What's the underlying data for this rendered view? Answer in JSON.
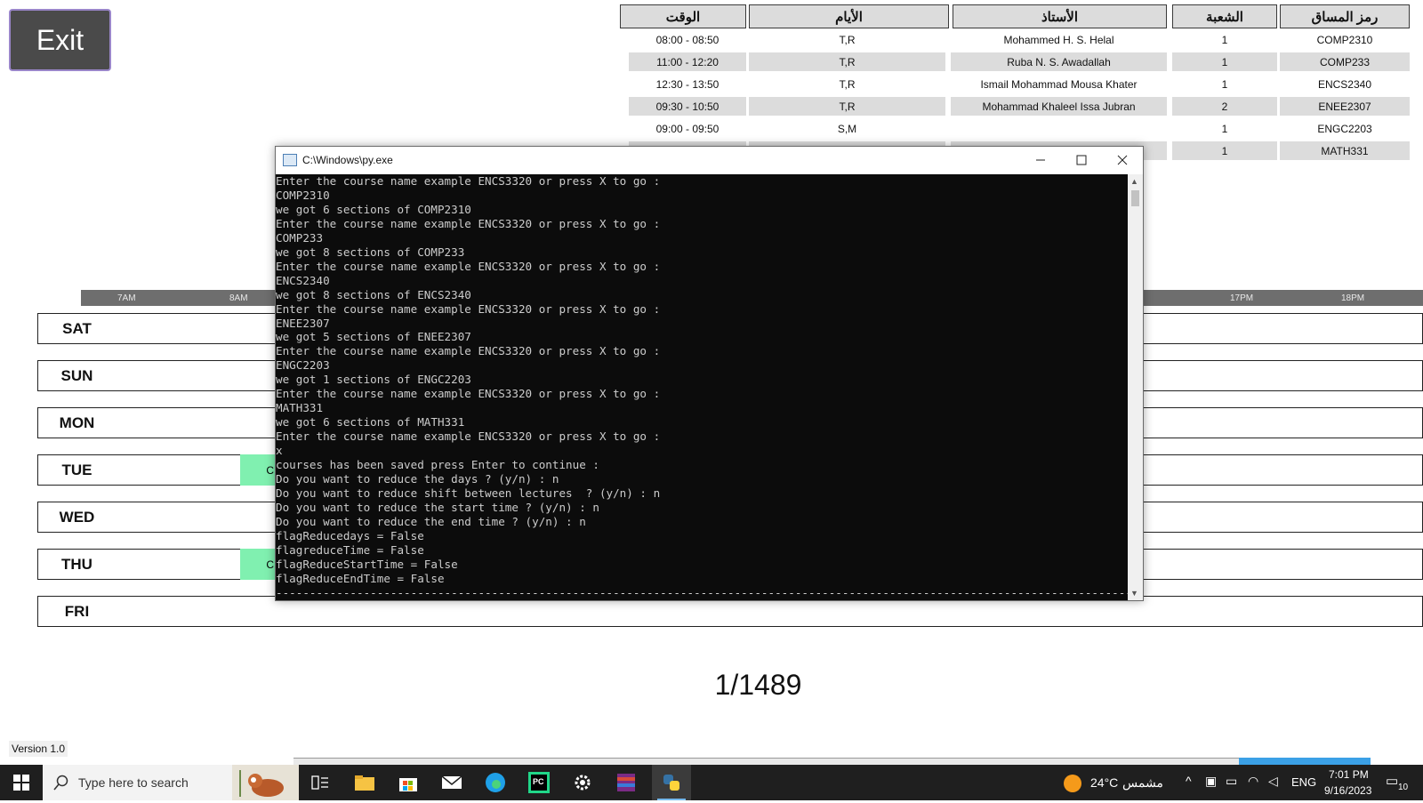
{
  "exit_button": {
    "label": "Exit"
  },
  "course_table": {
    "headers": [
      "الوقت",
      "الأيام",
      "الأستاذ",
      "الشعبة",
      "رمز المساق"
    ],
    "rows": [
      [
        "08:00 - 08:50",
        "T,R",
        "Mohammed H. S. Helal",
        "1",
        "COMP2310"
      ],
      [
        "11:00 - 12:20",
        "T,R",
        "Ruba N. S. Awadallah",
        "1",
        "COMP233"
      ],
      [
        "12:30 - 13:50",
        "T,R",
        "Ismail Mohammad Mousa Khater",
        "1",
        "ENCS2340"
      ],
      [
        "09:30 - 10:50",
        "T,R",
        "Mohammad Khaleel Issa Jubran",
        "2",
        "ENEE2307"
      ],
      [
        "09:00 - 09:50",
        "S,M",
        "",
        "1",
        "ENGC2203"
      ],
      [
        "",
        "",
        "",
        "1",
        "MATH331"
      ]
    ]
  },
  "schedule": {
    "hour_labels": [
      "7AM",
      "8AM",
      "17PM",
      "18PM"
    ],
    "days": [
      "SAT",
      "SUN",
      "MON",
      "TUE",
      "WED",
      "THU",
      "FRI"
    ],
    "block_label": "C"
  },
  "console": {
    "title": "C:\\Windows\\py.exe",
    "lines": [
      "Enter the course name example ENCS3320 or press X to go :",
      "COMP2310",
      "we got 6 sections of COMP2310",
      "Enter the course name example ENCS3320 or press X to go :",
      "COMP233",
      "we got 8 sections of COMP233",
      "Enter the course name example ENCS3320 or press X to go :",
      "ENCS2340",
      "we got 8 sections of ENCS2340",
      "Enter the course name example ENCS3320 or press X to go :",
      "ENEE2307",
      "we got 5 sections of ENEE2307",
      "Enter the course name example ENCS3320 or press X to go :",
      "ENGC2203",
      "we got 1 sections of ENGC2203",
      "Enter the course name example ENCS3320 or press X to go :",
      "MATH331",
      "we got 6 sections of MATH331",
      "Enter the course name example ENCS3320 or press X to go :",
      "x",
      "courses has been saved press Enter to continue :",
      "Do you want to reduce the days ? (y/n) : n",
      "Do you want to reduce shift between lectures  ? (y/n) : n",
      "Do you want to reduce the start time ? (y/n) : n",
      "Do you want to reduce the end time ? (y/n) : n",
      "flagReducedays = False",
      "flagreduceTime = False",
      "flagReduceStartTime = False",
      "flagReduceEndTime = False",
      "------------------------------------------------------------------------------------------------------------------------------------------"
    ]
  },
  "page_counter": "1/1489",
  "version": "Version 1.0",
  "taskbar": {
    "search_placeholder": "Type here to search",
    "weather_temp": "24°C",
    "weather_text": "مشمس",
    "language": "ENG",
    "time": "7:01 PM",
    "date": "9/16/2023",
    "notification_count": "10"
  }
}
